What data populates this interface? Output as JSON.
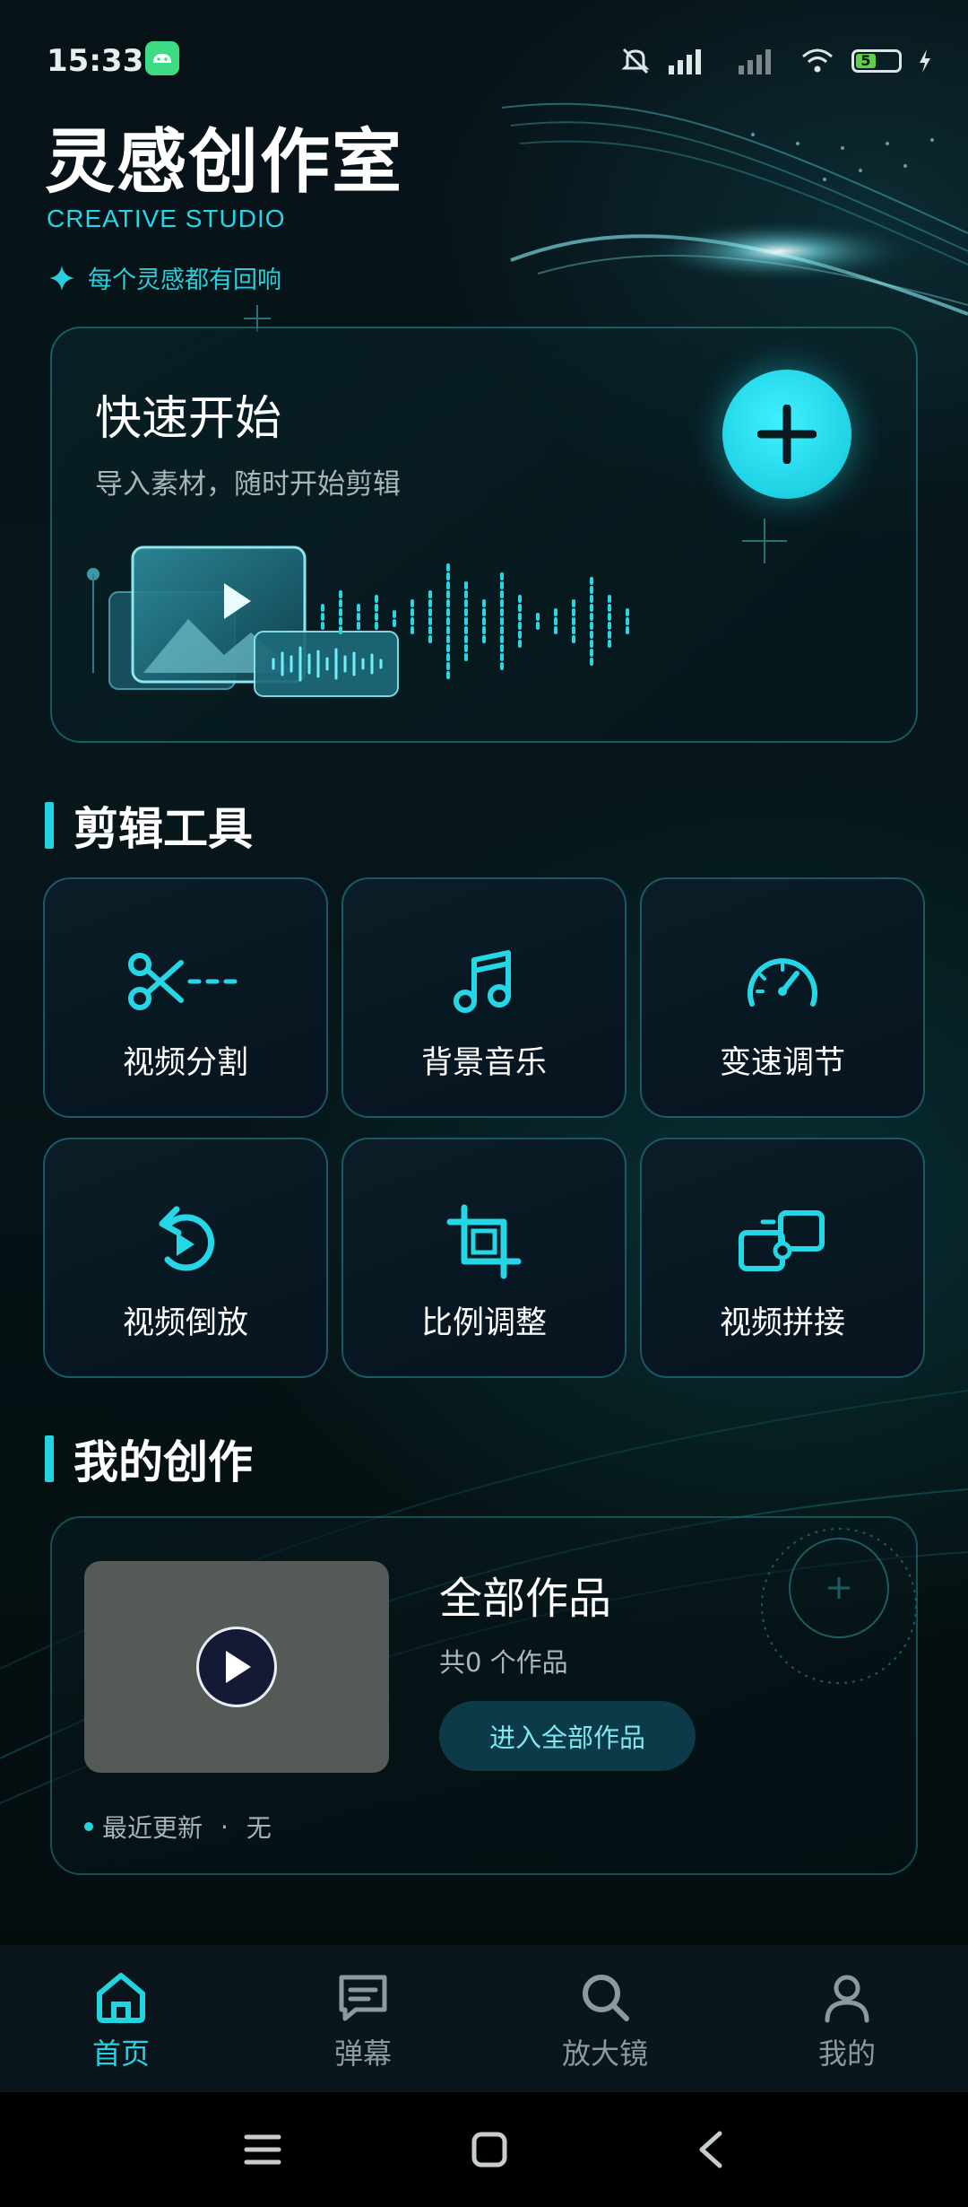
{
  "status_bar": {
    "time": "15:33",
    "battery": "5"
  },
  "header": {
    "title": "灵感创作室",
    "subtitle": "CREATIVE STUDIO",
    "slogan": "每个灵感都有回响"
  },
  "quick_start": {
    "title": "快速开始",
    "subtitle": "导入素材，随时开始剪辑",
    "add_icon": "plus-icon"
  },
  "tools_section": {
    "title": "剪辑工具",
    "items": [
      {
        "label": "视频分割",
        "icon": "scissors-icon"
      },
      {
        "label": "背景音乐",
        "icon": "music-note-icon"
      },
      {
        "label": "变速调节",
        "icon": "speedometer-icon"
      },
      {
        "label": "视频倒放",
        "icon": "reverse-play-icon"
      },
      {
        "label": "比例调整",
        "icon": "crop-icon"
      },
      {
        "label": "视频拼接",
        "icon": "puzzle-join-icon"
      }
    ]
  },
  "works_section": {
    "title": "我的创作",
    "card_title": "全部作品",
    "count_text": "共0 个作品",
    "button_label": "进入全部作品",
    "updated_label": "最近更新",
    "updated_sep": "·",
    "updated_value": "无"
  },
  "bottom_nav": {
    "items": [
      {
        "label": "首页",
        "icon": "home-icon",
        "active": true
      },
      {
        "label": "弹幕",
        "icon": "message-icon",
        "active": false
      },
      {
        "label": "放大镜",
        "icon": "search-icon",
        "active": false
      },
      {
        "label": "我的",
        "icon": "user-icon",
        "active": false
      }
    ]
  },
  "colors": {
    "accent": "#22d3e2",
    "background": "#071217",
    "card_border": "#2c8c9e"
  }
}
